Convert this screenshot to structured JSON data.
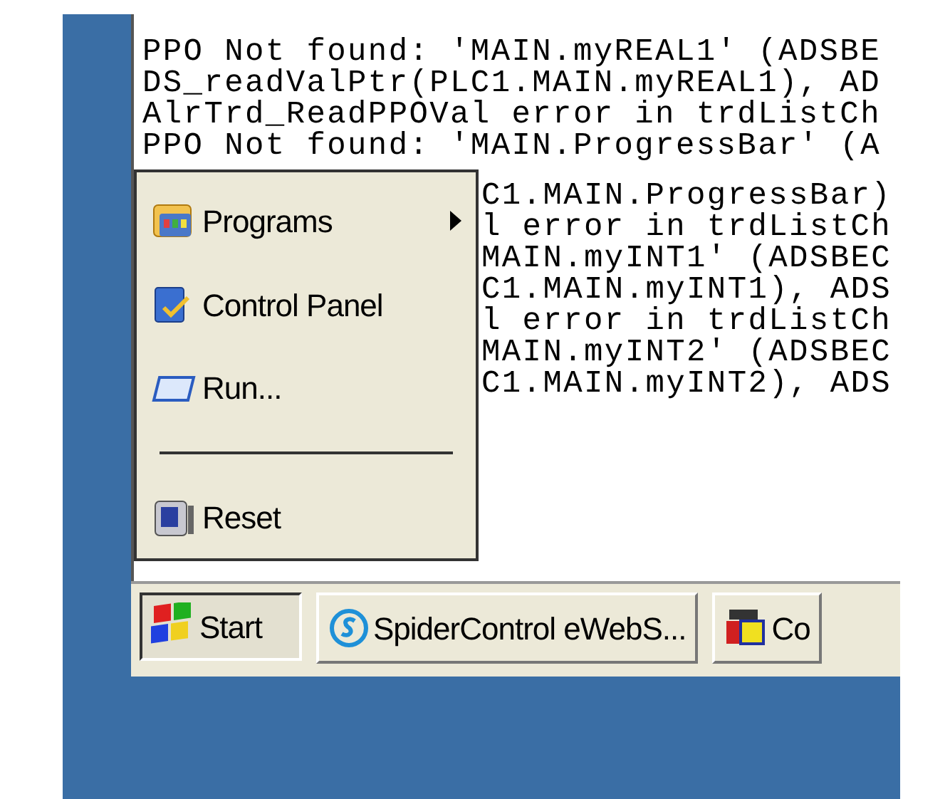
{
  "console": {
    "lines": [
      "PPO Not found: 'MAIN.myREAL1' (ADSBE",
      "DS_readValPtr(PLC1.MAIN.myREAL1), AD",
      "AlrTrd_ReadPPOVal error in trdListCh",
      "PPO Not found: 'MAIN.ProgressBar' (A"
    ],
    "lines_beside_menu": [
      "C1.MAIN.ProgressBar)",
      "l error in trdListCh",
      "MAIN.myINT1' (ADSBEC",
      "C1.MAIN.myINT1), ADS",
      "l error in trdListCh",
      "MAIN.myINT2' (ADSBEC",
      "C1.MAIN.myINT2), ADS"
    ]
  },
  "start_menu": {
    "items": [
      {
        "kind": "submenu",
        "label": "Programs"
      },
      {
        "kind": "item",
        "label": "Control Panel"
      },
      {
        "kind": "item",
        "label": "Run..."
      },
      {
        "kind": "separator"
      },
      {
        "kind": "item",
        "label": "Reset"
      }
    ]
  },
  "taskbar": {
    "start": {
      "label": "Start",
      "pressed": true
    },
    "buttons": [
      {
        "label": "SpiderControl eWebS..."
      },
      {
        "label": "Co"
      }
    ]
  }
}
